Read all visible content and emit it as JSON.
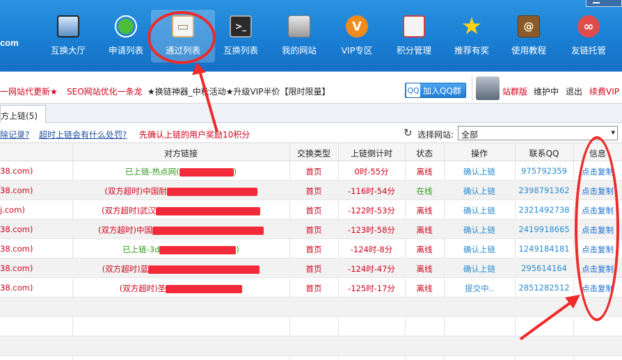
{
  "toolbar": {
    "logo_suffix": "com",
    "items": [
      {
        "label": "互换大厅",
        "icon": "screen-icon"
      },
      {
        "label": "申请列表",
        "icon": "pie-chart-icon"
      },
      {
        "label": "通过列表",
        "icon": "clipboard-icon"
      },
      {
        "label": "互换列表",
        "icon": "terminal-icon"
      },
      {
        "label": "我的网站",
        "icon": "door-icon"
      },
      {
        "label": "VIP专区",
        "icon": "vip-icon"
      },
      {
        "label": "积分管理",
        "icon": "calendar-icon"
      },
      {
        "label": "推荐有奖",
        "icon": "star-icon"
      },
      {
        "label": "使用教程",
        "icon": "book-icon"
      },
      {
        "label": "友链托管",
        "icon": "link-icon"
      }
    ],
    "active_index": 2,
    "vip_glyph": "V",
    "term_glyph": ">_",
    "book_glyph": "@",
    "star_glyph": "★",
    "link_glyph": "∞",
    "clip_glyph": "▭"
  },
  "notice": {
    "item1": "一网站代更新★",
    "item2": "SEO网站优化一条龙",
    "item3": "★换链神器_中秋活动★升级VIP半价【限时限量】",
    "qq_button": "加入QQ群",
    "qq_icon_glyph": "QQ",
    "user_links": [
      "站群版",
      "维护中",
      "退出",
      "续费VIP"
    ]
  },
  "tab": {
    "label": "方上链(5)"
  },
  "filter": {
    "link1": "除记录?",
    "link2": "超时上链会有什么处罚?",
    "reward_text": "先确认上链的用户奖励10积分",
    "refresh_glyph": "↻",
    "select_label": "选择网站:",
    "select_value": "全部",
    "select_arrow": "▾"
  },
  "table": {
    "headers": [
      "对方链接",
      "交换类型",
      "上链倒计时",
      "状态",
      "操作",
      "联系QQ",
      "信息"
    ],
    "rows": [
      {
        "left": "38.com)",
        "link": "已上链-热点网(",
        "link_tail": ")",
        "link_color": "green",
        "type": "首页",
        "time": "0时-55分",
        "status": "离线",
        "status_color": "red",
        "op": "确认上链",
        "qq": "975792359",
        "info": "点击复制"
      },
      {
        "left": "38.com)",
        "link": "(双方超时)中国耐",
        "link_tail": "",
        "link_color": "red",
        "type": "首页",
        "time": "-116时-54分",
        "status": "在线",
        "status_color": "green",
        "op": "确认上链",
        "qq": "2398791362",
        "info": "点击复制"
      },
      {
        "left": "j.com)",
        "link": "(双方超时)武汉",
        "link_tail": "",
        "link_color": "red",
        "type": "首页",
        "time": "-122时-53分",
        "status": "离线",
        "status_color": "red",
        "op": "确认上链",
        "qq": "2321492738",
        "info": "点击复制"
      },
      {
        "left": "38.com)",
        "link": "(双方超时)中国",
        "link_tail": "",
        "link_color": "red",
        "type": "首页",
        "time": "-123时-58分",
        "status": "离线",
        "status_color": "red",
        "op": "确认上链",
        "qq": "2419918665",
        "info": "点击复制"
      },
      {
        "left": "38.com)",
        "link": "已上链-3d",
        "link_tail": ")",
        "link_color": "green",
        "type": "首页",
        "time": "-124时-8分",
        "status": "离线",
        "status_color": "red",
        "op": "确认上链",
        "qq": "1249184181",
        "info": "点击复制"
      },
      {
        "left": "38.com)",
        "link": "(双方超时)蓝",
        "link_tail": "",
        "link_color": "red",
        "type": "首页",
        "time": "-124时-47分",
        "status": "离线",
        "status_color": "red",
        "op": "确认上链",
        "qq": "295614164",
        "info": "点击复制"
      },
      {
        "left": "38.com)",
        "link": "(双方超时)圣",
        "link_tail": "",
        "link_color": "red",
        "type": "首页",
        "time": "-125时-17分",
        "status": "离线",
        "status_color": "red",
        "op": "提交中..",
        "qq": "2851282512",
        "info": "点击复制"
      }
    ]
  },
  "colors": {
    "accent": "#1a7fd4",
    "annotation_red": "#ef2a2a",
    "status_online": "#2c9a1a",
    "status_offline": "#d0021b",
    "link_blue": "#2a8bd0"
  }
}
